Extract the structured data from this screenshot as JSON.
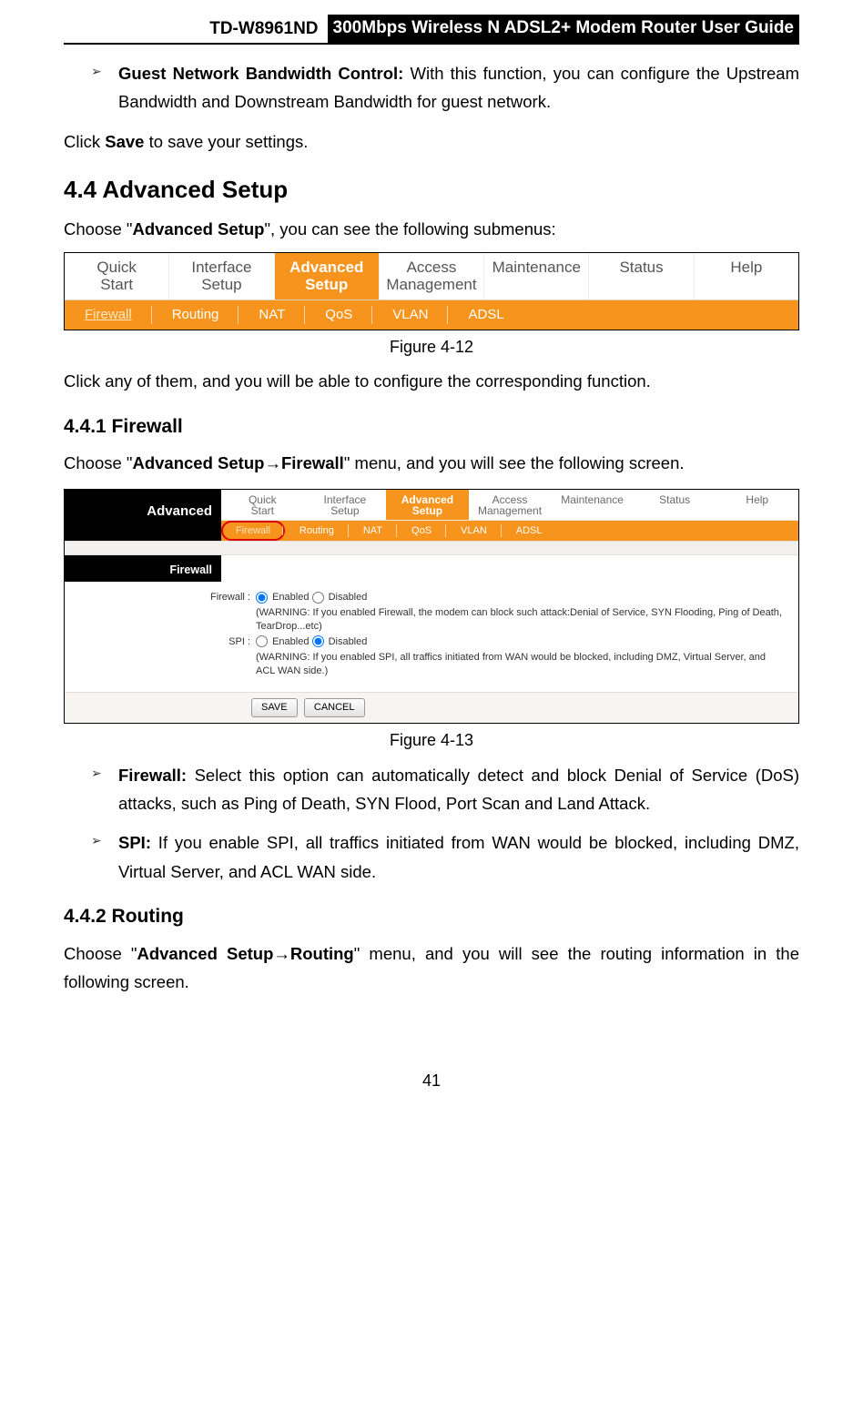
{
  "header": {
    "model": "TD-W8961ND",
    "title": "300Mbps Wireless N ADSL2+ Modem Router User Guide"
  },
  "bullet_gnbc": {
    "label": "Guest Network Bandwidth Control:",
    "text": " With this function, you can configure the Upstream Bandwidth and Downstream Bandwidth for guest network."
  },
  "save_line": {
    "pre": "Click ",
    "b": "Save",
    "post": " to save your settings."
  },
  "sec44_title": "4.4   Advanced Setup",
  "sec44_line": {
    "pre": "Choose \"",
    "b": "Advanced Setup",
    "post": "\", you can see the following submenus:"
  },
  "fig12": {
    "caption": "Figure 4-12",
    "main": [
      "Quick\nStart",
      "Interface\nSetup",
      "Advanced\nSetup",
      "Access\nManagement",
      "Maintenance",
      "Status",
      "Help"
    ],
    "active_main_index": 2,
    "sub": [
      "Firewall",
      "Routing",
      "NAT",
      "QoS",
      "VLAN",
      "ADSL"
    ],
    "selected_sub_index": 0
  },
  "click_any": "Click any of them, and you will be able to configure the corresponding function.",
  "sec441_title": "4.4.1  Firewall",
  "sec441_line": {
    "pre": "Choose \"",
    "b1": "Advanced Setup",
    "arrow": "→",
    "b2": "Firewall",
    "post": "\" menu, and you will see the following screen."
  },
  "fig13": {
    "caption": "Figure 4-13",
    "left_title": "Advanced",
    "section_label": "Firewall",
    "main": [
      "Quick\nStart",
      "Interface\nSetup",
      "Advanced\nSetup",
      "Access\nManagement",
      "Maintenance",
      "Status",
      "Help"
    ],
    "active_main_index": 2,
    "sub": [
      "Firewall",
      "Routing",
      "NAT",
      "QoS",
      "VLAN",
      "ADSL"
    ],
    "selected_sub_index": 0,
    "firewall": {
      "label": "Firewall :",
      "opt_enabled": "Enabled",
      "opt_disabled": "Disabled",
      "selected": "enabled",
      "warning": "(WARNING: If you enabled Firewall, the modem can block such attack:Denial of Service, SYN Flooding, Ping of Death, TearDrop...etc)"
    },
    "spi": {
      "label": "SPI :",
      "opt_enabled": "Enabled",
      "opt_disabled": "Disabled",
      "selected": "disabled",
      "warning": "(WARNING: If you enabled SPI, all traffics initiated from WAN would be blocked, including DMZ, Virtual Server, and ACL WAN side.)"
    },
    "save_btn": "SAVE",
    "cancel_btn": "CANCEL"
  },
  "bullet_firewall": {
    "label": "Firewall:",
    "text": " Select this option can automatically detect and block Denial of Service (DoS) attacks, such as Ping of Death, SYN Flood, Port Scan and Land Attack."
  },
  "bullet_spi": {
    "label": "SPI:",
    "text": " If you enable SPI, all traffics initiated from WAN would be blocked, including DMZ, Virtual Server, and ACL WAN side."
  },
  "sec442_title": "4.4.2  Routing",
  "sec442_line": {
    "pre": "Choose \"",
    "b1": "Advanced Setup",
    "arrow": "→",
    "b2": "Routing",
    "post": "\" menu, and you will see the routing information in the following screen."
  },
  "page_number": "41"
}
